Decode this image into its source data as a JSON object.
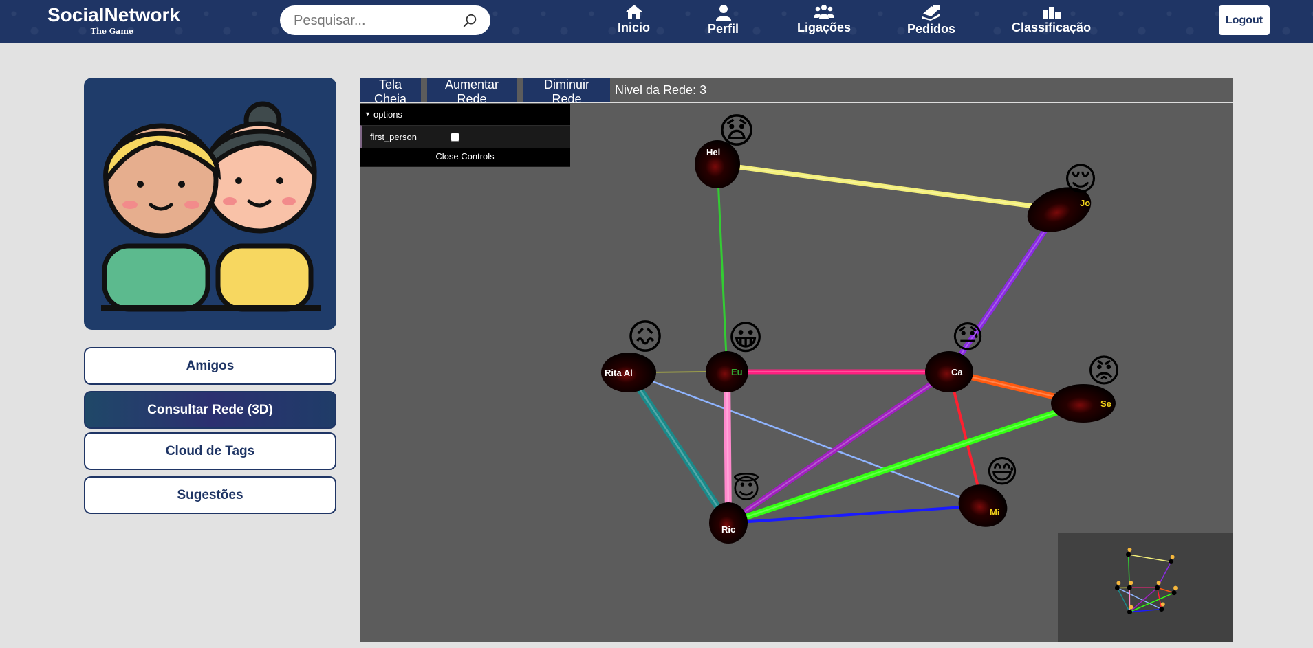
{
  "header": {
    "brand_title": "SocialNetwork",
    "brand_subtitle": "The Game",
    "search_placeholder": "Pesquisar...",
    "nav": [
      {
        "label": "Inicio",
        "icon": "home-icon"
      },
      {
        "label": "Perfil",
        "icon": "user-icon"
      },
      {
        "label": "Ligações",
        "icon": "group-icon"
      },
      {
        "label": "Pedidos",
        "icon": "requests-icon"
      },
      {
        "label": "Classificação",
        "icon": "podium-icon"
      }
    ],
    "logout_label": "Logout"
  },
  "sidebar": {
    "buttons": [
      {
        "label": "Amigos",
        "active": false
      },
      {
        "label": "Consultar Rede (3D)",
        "active": true
      },
      {
        "label": "Cloud de Tags",
        "active": false
      },
      {
        "label": "Sugestões",
        "active": false
      }
    ]
  },
  "network": {
    "toolbar": {
      "fullscreen_label": "Tela Cheia",
      "increase_label": "Aumentar Rede",
      "decrease_label": "Diminuir Rede",
      "level_label": "Nivel da Rede: 3"
    },
    "controls": {
      "folder_label": "options",
      "first_person_label": "first_person",
      "first_person_checked": false,
      "close_label": "Close Controls"
    },
    "nodes": [
      {
        "id": "hel",
        "label": "Hel",
        "emoji": "😧"
      },
      {
        "id": "jo",
        "label": "Jo",
        "emoji": "😌"
      },
      {
        "id": "rita",
        "label": "Rita Al",
        "emoji": "😖"
      },
      {
        "id": "eu",
        "label": "Eu",
        "emoji": "😀"
      },
      {
        "id": "ca",
        "label": "Ca",
        "emoji": "😓"
      },
      {
        "id": "se",
        "label": "Se",
        "emoji": "😡"
      },
      {
        "id": "ric",
        "label": "Ric",
        "emoji": "😇"
      },
      {
        "id": "mi",
        "label": "Mi",
        "emoji": "😅"
      }
    ],
    "edges": [
      {
        "from": "hel",
        "to": "jo",
        "color": "#f4f07a"
      },
      {
        "from": "hel",
        "to": "eu",
        "color": "#33cc33"
      },
      {
        "from": "jo",
        "to": "ca",
        "color": "#8a2be2"
      },
      {
        "from": "rita",
        "to": "eu",
        "color": "#d4d83a"
      },
      {
        "from": "rita",
        "to": "mi",
        "color": "#8fb4ff"
      },
      {
        "from": "rita",
        "to": "ric",
        "color": "#1a8a8a"
      },
      {
        "from": "eu",
        "to": "ca",
        "color": "#ff2080"
      },
      {
        "from": "eu",
        "to": "ric",
        "color": "#ff88cc"
      },
      {
        "from": "ca",
        "to": "se",
        "color": "#ff5a10"
      },
      {
        "from": "ca",
        "to": "mi",
        "color": "#ff2030"
      },
      {
        "from": "ca",
        "to": "ric",
        "color": "#a020c0"
      },
      {
        "from": "se",
        "to": "ric",
        "color": "#33ff11"
      },
      {
        "from": "ric",
        "to": "mi",
        "color": "#1a1aff"
      }
    ]
  }
}
